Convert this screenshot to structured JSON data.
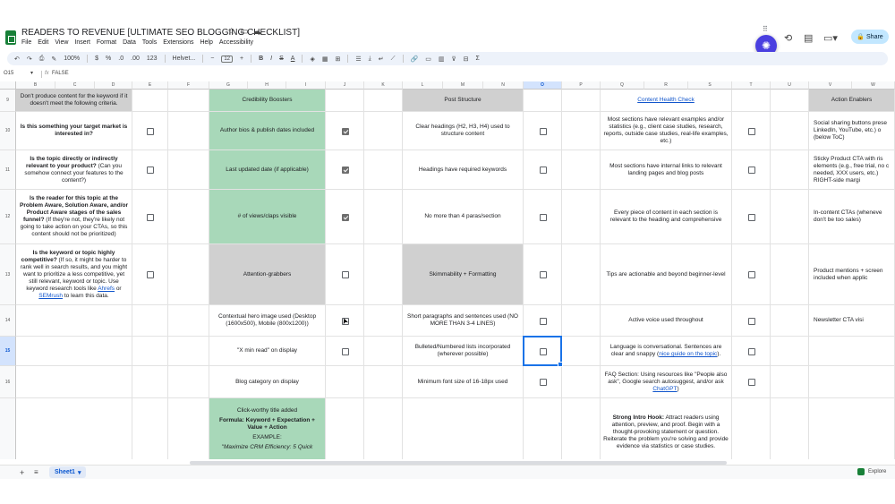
{
  "doc": {
    "title": "READERS TO REVENUE [ULTIMATE SEO BLOGGING CHECKLIST]",
    "menu": [
      "File",
      "Edit",
      "View",
      "Insert",
      "Format",
      "Data",
      "Tools",
      "Extensions",
      "Help",
      "Accessibility"
    ],
    "share_label": "Share"
  },
  "toolbar": {
    "zoom": "100%",
    "font": "Helvet...",
    "font_size": "12",
    "currency": "$",
    "percent": "%",
    "dec_less": ".0",
    "dec_more": ".00",
    "number_format": "123"
  },
  "formula_bar": {
    "cell_ref": "O15",
    "fx": "fx",
    "value": "FALSE"
  },
  "columns": [
    "B",
    "C",
    "D",
    "E",
    "F",
    "G",
    "H",
    "I",
    "J",
    "K",
    "L",
    "M",
    "N",
    "O",
    "P",
    "Q",
    "R",
    "S",
    "T",
    "U",
    "V",
    "W"
  ],
  "selected_column": "O",
  "rows": [
    "9",
    "10",
    "11",
    "12",
    "13",
    "14",
    "15",
    "16",
    ""
  ],
  "selected_row": "15",
  "headers": {
    "keyword_note": "Don't produce content for the keyword if it doesn't meet the following criteria.",
    "credibility": "Credibility Boosters",
    "post_structure": "Post Structure",
    "content_health": "Content Health Check",
    "action_enablers": "Action Enablers"
  },
  "keyword_questions": [
    {
      "bold": "Is this something your target market is interested in?",
      "rest": ""
    },
    {
      "bold": "Is the topic directly or indirectly relevant to your product?",
      "rest": " (Can you somehow connect your features to the content?)"
    },
    {
      "bold": "Is the reader for this topic at the Problem Aware, Solution Aware, and/or Product Aware stages of the sales funnel?",
      "rest": " (If they're not, they're likely not going to take action on your CTAs, so this content should not be prioritized)"
    },
    {
      "bold": "Is the keyword or topic highly competitive?",
      "rest": " (If so, it might be harder to rank well in search results, and you might want to prioritize a less competitive, yet still relevant, keyword or topic. Use keyword research tools like ",
      "link1": "Ahrefs",
      "mid": " or ",
      "link2": "SEMrush",
      "end": " to learn this data."
    }
  ],
  "credibility_items": [
    "Author bios & publish dates included",
    "Last updated date (if applicable)",
    "# of views/claps visible",
    "Attention-grabbers",
    "Contextual hero image used (Desktop (1600x500), Mobile (800x1200))",
    "\"X min read\" on display",
    "Blog category on display"
  ],
  "clickworthy": {
    "title": "Click-worthy title added",
    "formula": "Formula: Keyword + Expectation + Value + Action",
    "example_label": "EXAMPLE:",
    "example": "\"Maximize CRM Efficiency: 5 Quick"
  },
  "structure_items": [
    "Clear headings (H2, H3, H4) used to structure content",
    "Headings have required keywords",
    "No more than 4 paras/section",
    "Skimmability + Formatting",
    "Short paragraphs and sentences used (NO MORE THAN 3-4 LINES)",
    "Bulleted/Numbered lists incorporated (wherever possible)",
    "Minimum font size of 16-18px used"
  ],
  "health_items": [
    "Most sections have relevant examples and/or statistics (e.g., client case studies, research, reports, outside case studies, real-life examples, etc.)",
    "Most sections have internal links to relevant landing pages and blog posts",
    "Every piece of content in each section is relevant to the heading and comprehensive",
    "Tips are actionable and beyond beginner-level",
    "Active voice used throughout"
  ],
  "health_conversational": {
    "text": "Language is conversational. Sentences are clear and snappy (",
    "link": "nice guide on the topic",
    "end": ")."
  },
  "health_faq": {
    "text": "FAQ Section: Using resources like \"People also ask\", Google search autosuggest, and/or ask ",
    "link": "ChatGPT",
    "end": ")"
  },
  "health_intro": {
    "bold": "Strong Intro Hook:",
    "text": " Attract readers using attention, preview, and proof. Begin with a thought-provoking statement or question. Reiterate the problem you're solving and provide evidence via statistics or case studies."
  },
  "action_items": [
    "Social sharing buttons prese LinkedIn, YouTube, etc.) o (below ToC)",
    "Sticky Product CTA with ris elements (e.g., free trial, no c needed, XXX users, etc.) RIGHT-side margi",
    "In-content CTAs (wheneve don't be too sales)",
    "Product mentions + screen included when applic",
    "Newsletter CTA visi"
  ],
  "checkboxes": {
    "e": [
      false,
      false,
      false,
      false
    ],
    "j": [
      true,
      true,
      true,
      false,
      false,
      false
    ],
    "o": [
      false,
      false,
      false,
      false,
      false,
      false,
      false
    ],
    "t": [
      false,
      false,
      false,
      false,
      false,
      false,
      false
    ]
  },
  "sheet": {
    "tab": "Sheet1",
    "explore": "Explore"
  },
  "icons": [
    "star-icon",
    "move-folder-icon",
    "cloud-status-icon",
    "history-icon",
    "comment-icon",
    "meet-icon",
    "gemini-icon",
    "lock-icon",
    "plus-icon",
    "list-icon",
    "checkbox-icon"
  ],
  "colors": {
    "green_fill": "#a8d8b9",
    "gray_fill": "#d0d0d0",
    "accent": "#1a73e8"
  }
}
